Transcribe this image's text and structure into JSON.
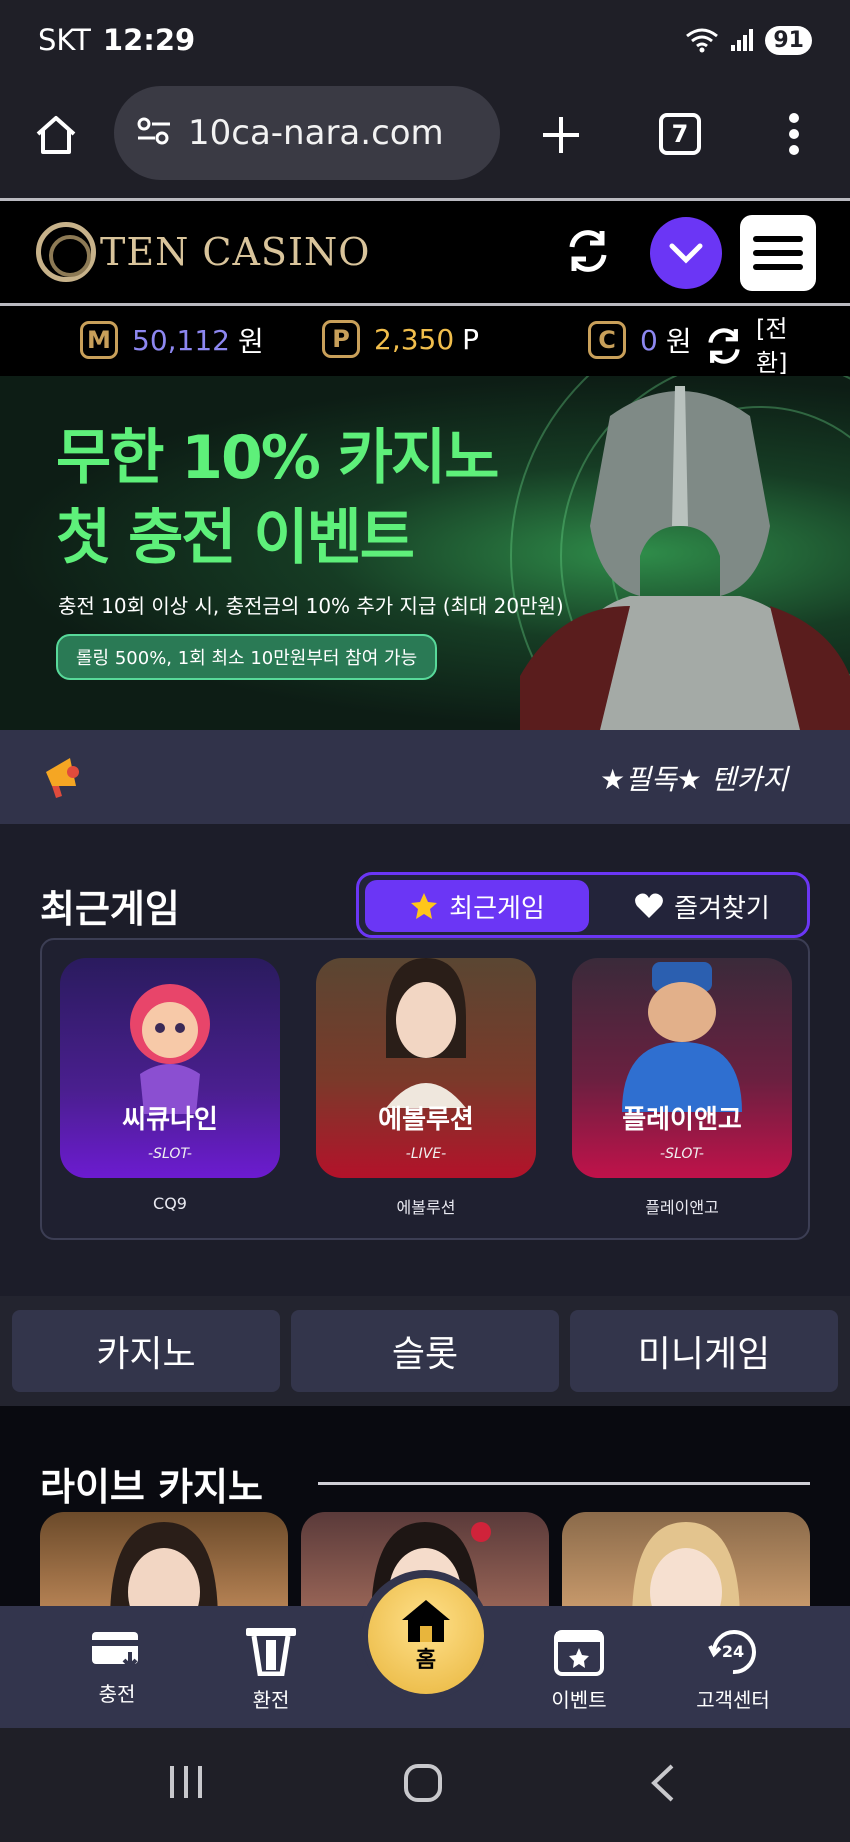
{
  "status_bar": {
    "carrier": "SKT",
    "time": "12:29",
    "battery": "91"
  },
  "browser": {
    "url": "10ca-nara.com",
    "tab_count": "7"
  },
  "site": {
    "logo_text": "TEN CASINO",
    "points": {
      "money_badge": "M",
      "money_value": "50,112",
      "money_unit": "원",
      "point_badge": "P",
      "point_value": "2,350",
      "point_unit": "P",
      "casino_badge": "C",
      "casino_value": "0",
      "casino_unit": "원",
      "convert_label": "[전환]"
    }
  },
  "banner": {
    "headline_1": "무한 10% 카지노",
    "headline_2": "첫 충전 이벤트",
    "subtext": "충전 10회 이상 시, 충전금의 10% 추가 지급 (최대 20만원)",
    "pill": "롤링 500%, 1회 최소 10만원부터 참여 가능"
  },
  "notice": {
    "message": "★필독★ 텐카지"
  },
  "recent_games": {
    "title": "최근게임",
    "tab_recent": "최근게임",
    "tab_favorites": "즐겨찾기",
    "items": [
      {
        "title": "씨큐나인",
        "tag": "-SLOT-",
        "name": "CQ9"
      },
      {
        "title": "에볼루션",
        "tag": "-LIVE-",
        "name": "에볼루션"
      },
      {
        "title": "플레이앤고",
        "tag": "-SLOT-",
        "name": "플레이앤고"
      }
    ]
  },
  "categories": [
    "카지노",
    "슬롯",
    "미니게임"
  ],
  "live_casino": {
    "title": "라이브 카지노"
  },
  "bottom_nav": {
    "charge": "충전",
    "exchange": "환전",
    "home": "홈",
    "event": "이벤트",
    "support": "고객센터"
  },
  "colors": {
    "accent": "#6b36f5",
    "gold": "#e8b53c",
    "banner_green": "#5ef07a"
  },
  "icons": [
    "home-icon",
    "tune-icon",
    "plus-icon",
    "more-icon",
    "refresh-icon",
    "chevron-down-icon",
    "menu-icon",
    "megaphone-icon",
    "star-icon",
    "heart-icon",
    "card-icon",
    "atm-icon",
    "calendar-star-icon",
    "support-24-icon"
  ]
}
